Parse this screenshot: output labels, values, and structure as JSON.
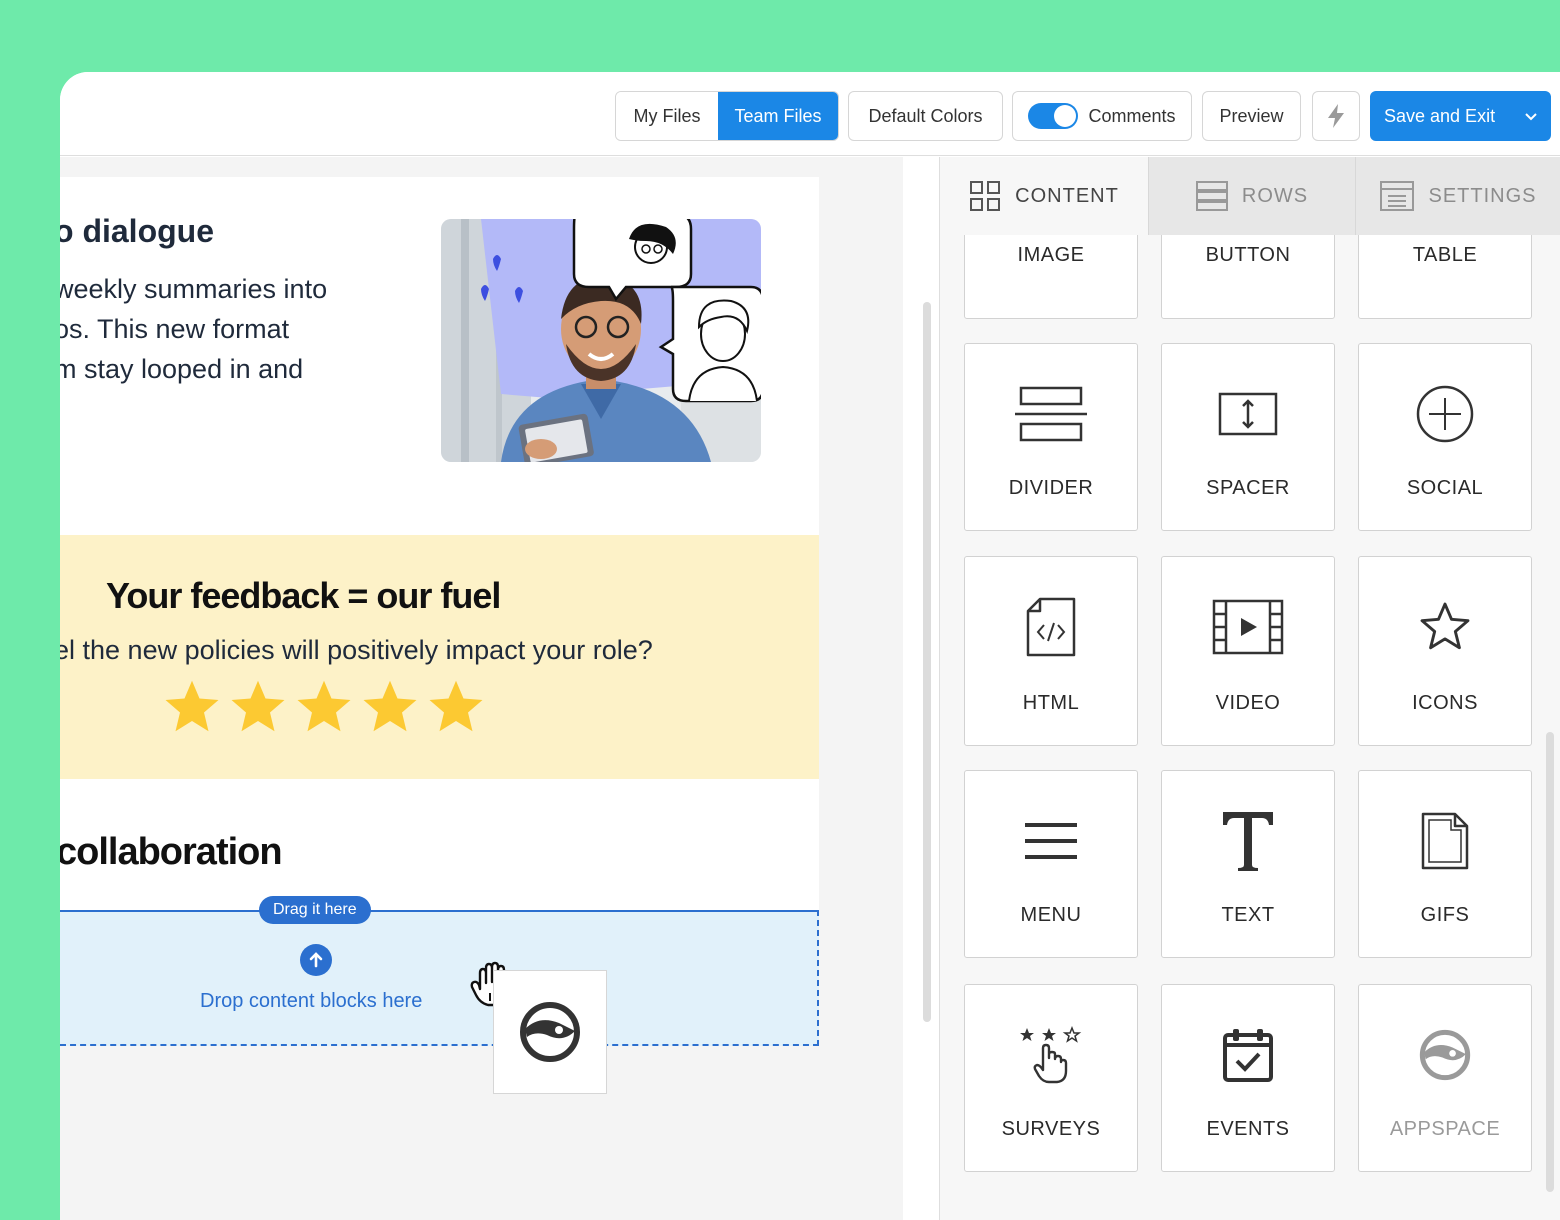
{
  "toolbar": {
    "my_files": "My Files",
    "team_files": "Team Files",
    "default_colors": "Default Colors",
    "comments": "Comments",
    "preview": "Preview",
    "save_exit": "Save and Exit"
  },
  "email": {
    "heading1": "o dialogue",
    "para_lines": [
      "weekly summaries into",
      "os. This new format",
      "m stay looped in and",
      "."
    ],
    "feedback_heading": "Your feedback = our fuel",
    "question": "el the new policies will positively impact your role?",
    "rating": {
      "value": 5,
      "max": 5
    },
    "collab_heading": "collaboration",
    "drag_tag": "Drag it here",
    "drop_text": "Drop content blocks here"
  },
  "panel": {
    "tabs": [
      {
        "label": "CONTENT",
        "active": true
      },
      {
        "label": "ROWS",
        "active": false
      },
      {
        "label": "SETTINGS",
        "active": false
      }
    ],
    "tiles": [
      {
        "label": "IMAGE",
        "icon": "image-icon"
      },
      {
        "label": "BUTTON",
        "icon": "button-icon"
      },
      {
        "label": "TABLE",
        "icon": "table-icon"
      },
      {
        "label": "DIVIDER",
        "icon": "divider-icon"
      },
      {
        "label": "SPACER",
        "icon": "spacer-icon"
      },
      {
        "label": "SOCIAL",
        "icon": "social-icon"
      },
      {
        "label": "HTML",
        "icon": "html-icon"
      },
      {
        "label": "VIDEO",
        "icon": "video-icon"
      },
      {
        "label": "ICONS",
        "icon": "star-icon"
      },
      {
        "label": "MENU",
        "icon": "menu-icon"
      },
      {
        "label": "TEXT",
        "icon": "text-icon"
      },
      {
        "label": "GIFS",
        "icon": "gif-icon"
      },
      {
        "label": "SURVEYS",
        "icon": "survey-icon"
      },
      {
        "label": "EVENTS",
        "icon": "calendar-icon"
      },
      {
        "label": "APPSPACE",
        "icon": "appspace-icon"
      }
    ]
  },
  "colors": {
    "accent": "#1b87e6",
    "drop_accent": "#2b6fcf",
    "background": "#6eeaaa",
    "star": "#fcc932",
    "feedback_bg": "#fdf2c8"
  }
}
